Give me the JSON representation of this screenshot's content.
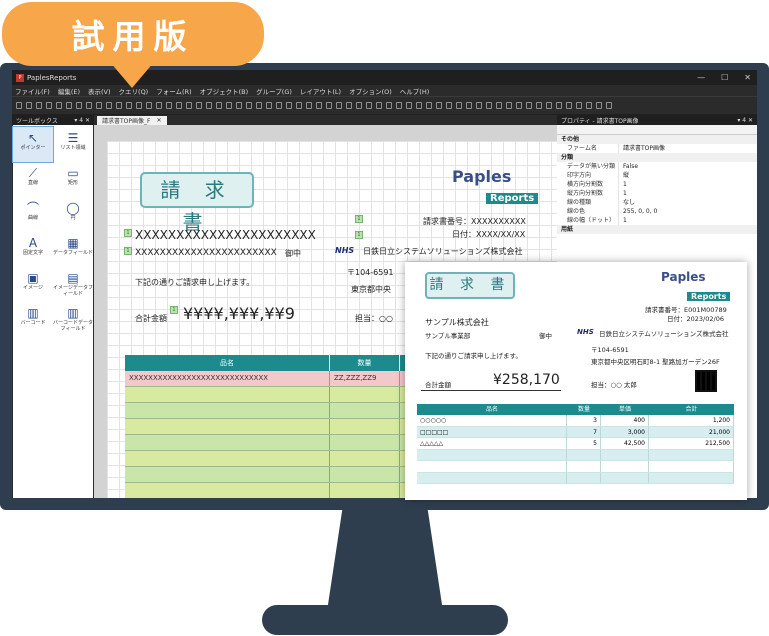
{
  "badge": {
    "label": "試用版"
  },
  "window": {
    "title": "PaplesReports",
    "controls": [
      "—",
      "☐",
      "✕"
    ]
  },
  "menu": [
    "ファイル(F)",
    "編集(E)",
    "表示(V)",
    "クエリ(Q)",
    "フォーム(R)",
    "オブジェクト(B)",
    "グループ(G)",
    "レイアウト(L)",
    "オプション(O)",
    "ヘルプ(H)"
  ],
  "toolbox": {
    "title": "ツールボックス",
    "pin": "▾ 4 ✕",
    "items": [
      {
        "label": "ポインター",
        "icon": "pointer-icon",
        "glyph": "↖",
        "selected": true
      },
      {
        "label": "リスト領域",
        "icon": "list-icon",
        "glyph": "☰"
      },
      {
        "label": "直線",
        "icon": "line-icon",
        "glyph": "⟋"
      },
      {
        "label": "矩形",
        "icon": "rectangle-icon",
        "glyph": "▭"
      },
      {
        "label": "曲線",
        "icon": "curve-icon",
        "glyph": "⌒"
      },
      {
        "label": "円",
        "icon": "circle-icon",
        "glyph": "◯"
      },
      {
        "label": "固定文字",
        "icon": "text-icon",
        "glyph": "A"
      },
      {
        "label": "データフィールド",
        "icon": "datafield-icon",
        "glyph": "▦"
      },
      {
        "label": "イメージ",
        "icon": "image-icon",
        "glyph": "▣"
      },
      {
        "label": "イメージデータフィールド",
        "icon": "image-datafield-icon",
        "glyph": "▤"
      },
      {
        "label": "バーコード",
        "icon": "barcode-icon",
        "glyph": "▥"
      },
      {
        "label": "バーコードデータフィールド",
        "icon": "barcode-datafield-icon",
        "glyph": "▥"
      }
    ]
  },
  "document": {
    "tab": "請求書TOP画像_F",
    "tab_close": "✕",
    "title": "請 求 書",
    "customer1": "XXXXXXXXXXXXXXXXXXXXXX",
    "customer2": "XXXXXXXXXXXXXXXXXXXXXXX",
    "honorific": "御中",
    "invoice_no": "請求書番号：XXXXXXXXXX",
    "date": "日付：XXXX/XX/XX",
    "company": "日鉄日立システムソリューションズ株式会社",
    "company_logo": "NHS",
    "zip": "〒104-6591",
    "address": "東京都中央",
    "note": "下記の通りご請求申し上げます。",
    "total_label": "合計金額",
    "total_value": "¥¥¥¥,¥¥¥,¥¥9",
    "staff": "担当：○○",
    "mark": "1",
    "brand_top": "Paples",
    "brand_bottom": "Reports",
    "table_headers": [
      "品名",
      "数量",
      ""
    ],
    "table_row0": [
      "XXXXXXXXXXXXXXXXXXXXXXXXXXXXX",
      "ZZ,ZZZ,ZZ9",
      ""
    ]
  },
  "properties": {
    "title": "プロパティ - 請求書TOP画像",
    "pin": "▾ 4 ✕",
    "categories": [
      {
        "name": "その他",
        "rows": [
          [
            "ファーム名",
            "請求書TOP画像"
          ]
        ]
      },
      {
        "name": "分類",
        "rows": [
          [
            "データが無い分類",
            "False"
          ],
          [
            "印字方向",
            "縦"
          ],
          [
            "横方向分割数",
            "1"
          ],
          [
            "縦方向分割数",
            "1"
          ],
          [
            "線の種類",
            "なし"
          ],
          [
            "線の色",
            "255, 0, 0, 0"
          ],
          [
            "線の幅（ドット）",
            "1"
          ]
        ]
      },
      {
        "name": "用紙",
        "rows": []
      }
    ]
  },
  "preview": {
    "title": "請 求 書",
    "brand_top": "Paples",
    "brand_bottom": "Reports",
    "invoice_no": "請求書番号：E001M00789",
    "date": "日付：2023/02/06",
    "customer": "サンプル株式会社",
    "dept": "サンプル事業部",
    "honorific": "御中",
    "company_logo": "NHS",
    "company": "日鉄日立システムソリューションズ株式会社",
    "zip": "〒104-6591",
    "address": "東京都中央区明石町8-1 聖路加ガーデン26F",
    "note": "下記の通りご請求申し上げます。",
    "total_label": "合計金額",
    "total_value": "¥258,170",
    "staff": "担当：○○ 太郎",
    "headers": [
      "品名",
      "数量",
      "単価",
      "合計"
    ],
    "rows": [
      [
        "○○○○○",
        "3",
        "400",
        "1,200"
      ],
      [
        "□□□□□",
        "7",
        "3,000",
        "21,000"
      ],
      [
        "△△△△△",
        "5",
        "42,500",
        "212,500"
      ],
      [
        "",
        "",
        "",
        ""
      ],
      [
        "",
        "",
        "",
        ""
      ],
      [
        "",
        "",
        "",
        ""
      ]
    ]
  },
  "colors": {
    "badge": "#f7a64a",
    "monitor": "#2e3e4f",
    "table_header": "#1d8a8d",
    "brand_blue": "#3a4f88"
  }
}
